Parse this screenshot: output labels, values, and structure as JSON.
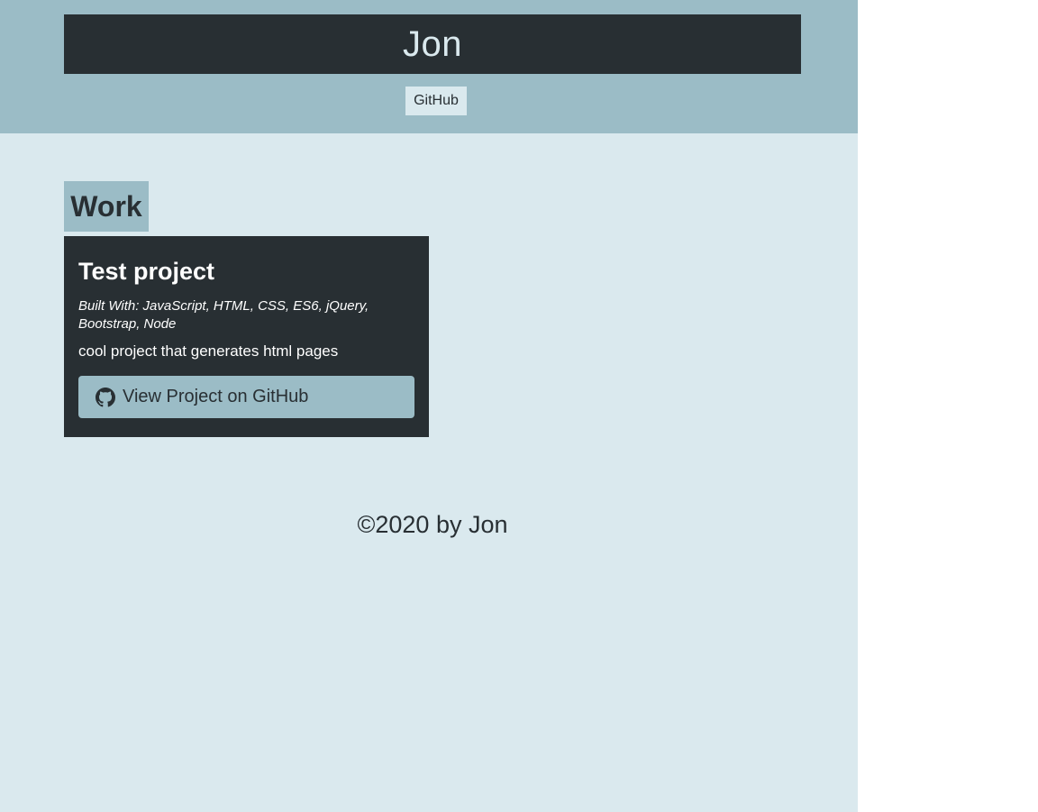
{
  "header": {
    "title": "Jon",
    "nav_github_label": "GitHub"
  },
  "work": {
    "heading": "Work",
    "projects": [
      {
        "title": "Test project",
        "built_with": "Built With: JavaScript, HTML, CSS, ES6, jQuery, Bootstrap, Node",
        "description": "cool project that generates html pages",
        "button_label": "View Project on GitHub",
        "button_icon": "github-icon"
      }
    ]
  },
  "footer": {
    "copyright": "©2020 by Jon"
  },
  "colors": {
    "header_bg": "#9bbcc6",
    "page_bg": "#dae9ee",
    "dark": "#282f33",
    "accent": "#9bbcc6"
  }
}
